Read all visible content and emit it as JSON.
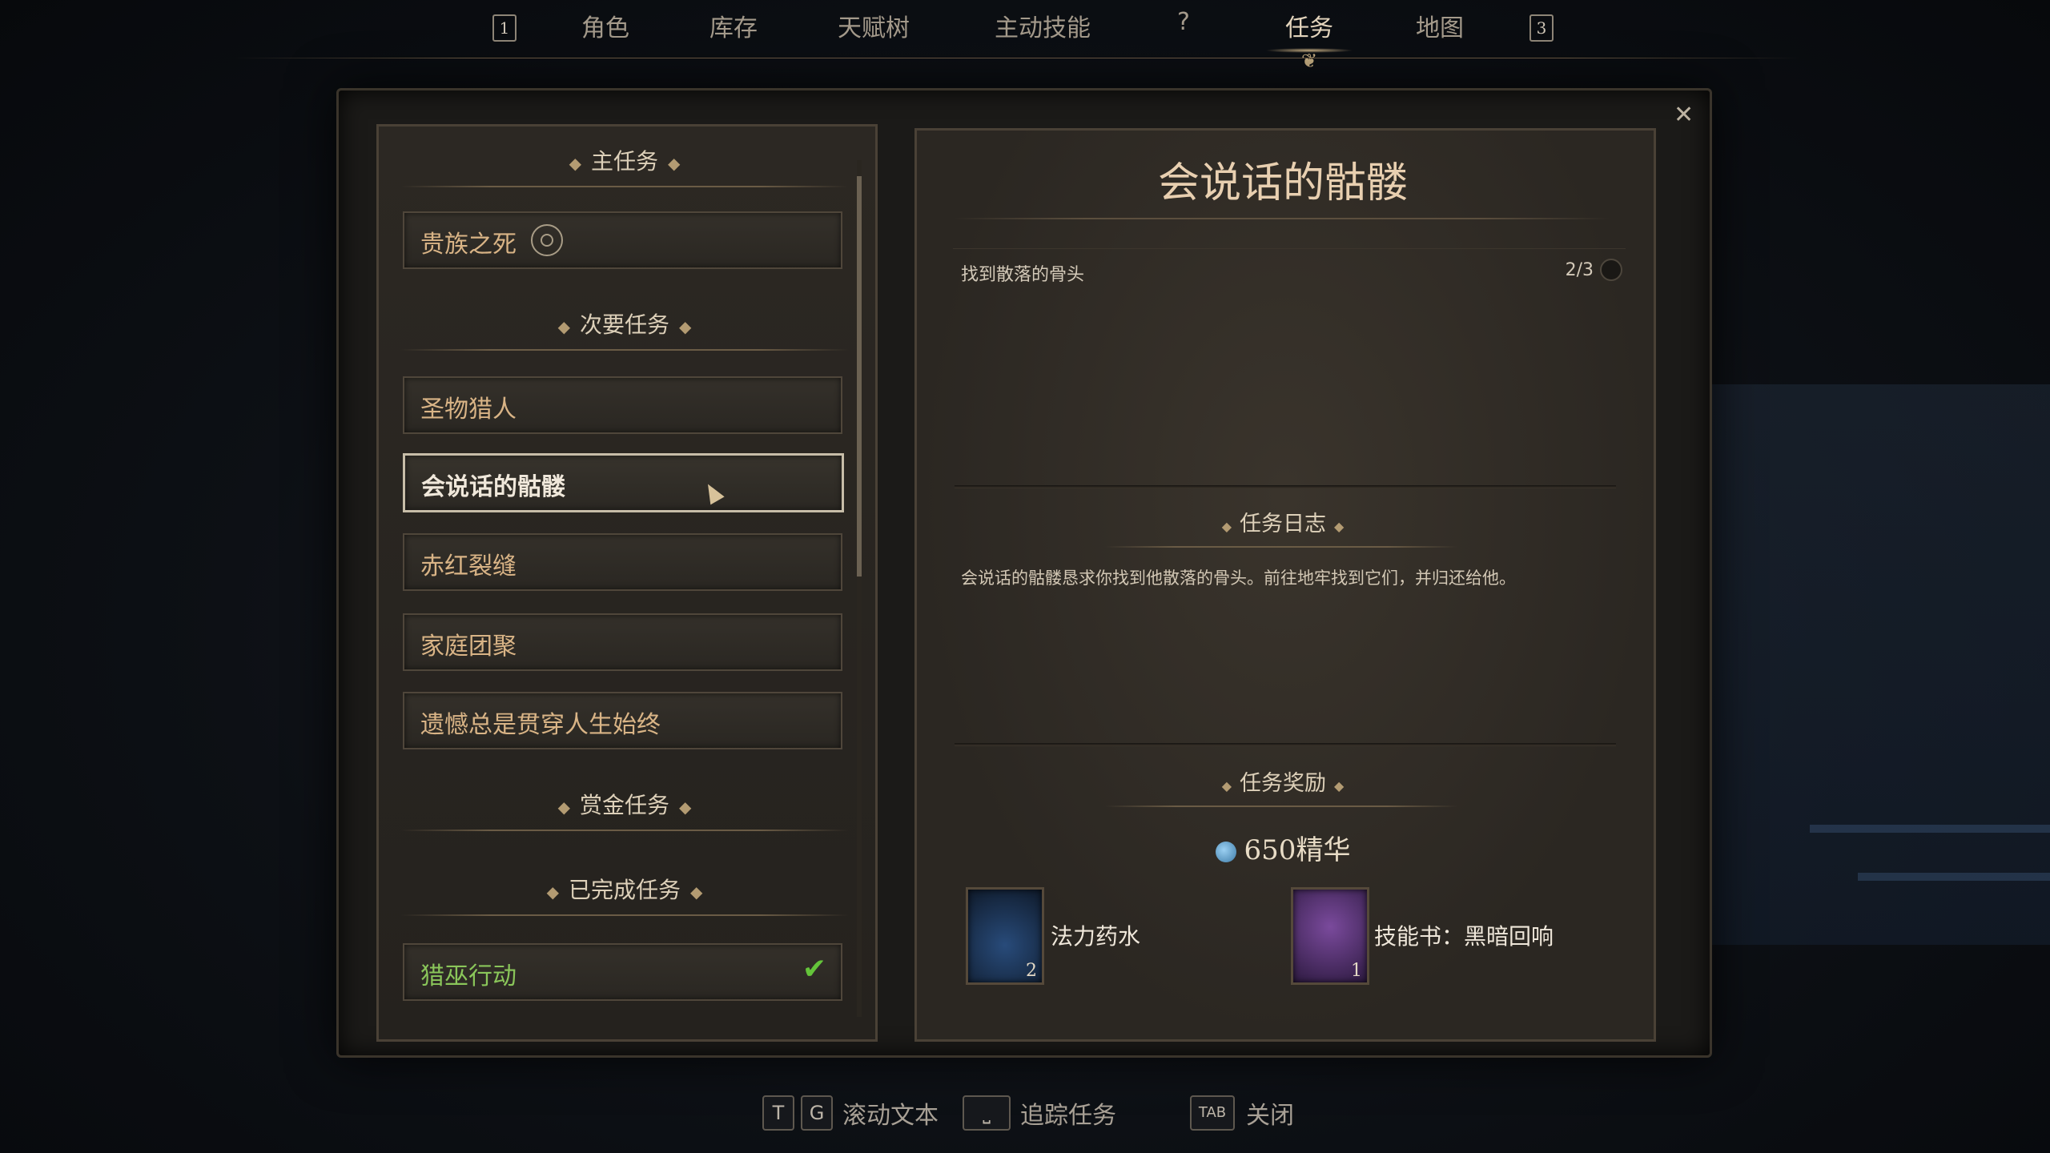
{
  "nav": {
    "key_left": "1",
    "key_right": "3",
    "tabs": [
      {
        "label": "角色"
      },
      {
        "label": "库存"
      },
      {
        "label": "天赋树"
      },
      {
        "label": "主动技能"
      },
      {
        "label": "?"
      },
      {
        "label": "任务"
      },
      {
        "label": "地图"
      }
    ],
    "active_tab": "任务"
  },
  "quest_list": {
    "main_header": "主任务",
    "main_quests": [
      {
        "label": "贵族之死",
        "tracked": true
      }
    ],
    "side_header": "次要任务",
    "side_quests": [
      {
        "label": "圣物猎人"
      },
      {
        "label": "会说话的骷髅",
        "selected": true
      },
      {
        "label": "赤红裂缝"
      },
      {
        "label": "家庭团聚"
      },
      {
        "label": "遗憾总是贯穿人生始终"
      }
    ],
    "bounty_header": "赏金任务",
    "completed_header": "已完成任务",
    "completed_quests": [
      {
        "label": "猎巫行动",
        "done": true
      }
    ]
  },
  "quest_detail": {
    "title": "会说话的骷髅",
    "objective": {
      "text": "找到散落的骨头",
      "progress": "2/3"
    },
    "log_header": "任务日志",
    "log_text": "会说话的骷髅恳求你找到他散落的骨头。前往地牢找到它们，并归还给他。",
    "rewards_header": "任务奖励",
    "essence": "650精华",
    "rewards": [
      {
        "label": "法力药水",
        "count": "2",
        "icon": "mana-potion-icon"
      },
      {
        "label": "技能书：黑暗回响",
        "count": "1",
        "icon": "skill-book-icon"
      }
    ]
  },
  "footer": {
    "scroll_keys": [
      "T",
      "G"
    ],
    "scroll_label": "滚动文本",
    "track_key": "space",
    "track_label": "追踪任务",
    "close_key": "TAB",
    "close_label": "关闭"
  },
  "colors": {
    "accent": "#d9b486",
    "completed": "#8ac65a",
    "check": "#64c43a"
  }
}
